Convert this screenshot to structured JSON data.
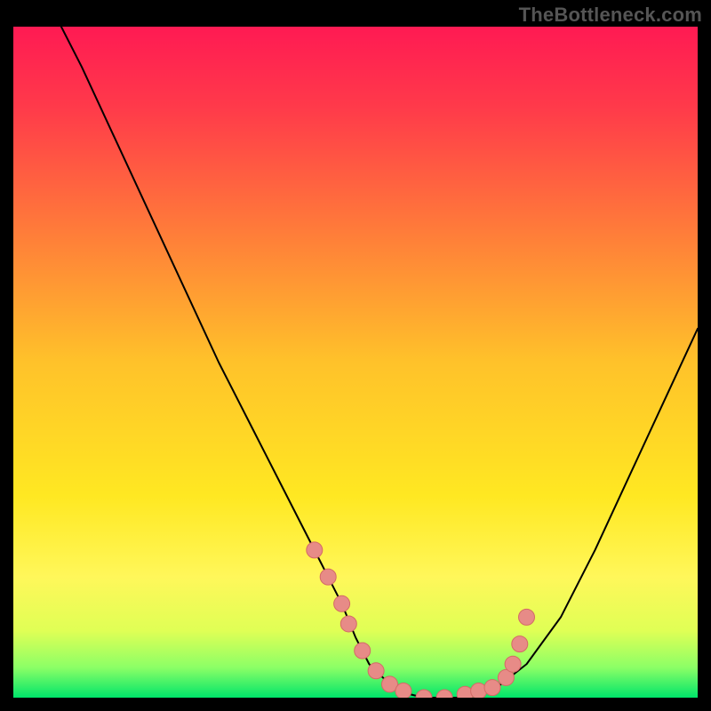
{
  "watermark": "TheBottleneck.com",
  "colors": {
    "frame": "#000000",
    "gradient_stops": [
      {
        "offset": 0.0,
        "color": "#ff1a53"
      },
      {
        "offset": 0.12,
        "color": "#ff3a4a"
      },
      {
        "offset": 0.3,
        "color": "#ff7a3a"
      },
      {
        "offset": 0.5,
        "color": "#ffc22a"
      },
      {
        "offset": 0.7,
        "color": "#ffe822"
      },
      {
        "offset": 0.82,
        "color": "#fff75a"
      },
      {
        "offset": 0.9,
        "color": "#e0ff55"
      },
      {
        "offset": 0.955,
        "color": "#8cff66"
      },
      {
        "offset": 1.0,
        "color": "#00e56a"
      }
    ],
    "curve": "#000000",
    "marker_fill": "#e78b87",
    "marker_stroke": "#d46a66"
  },
  "chart_data": {
    "type": "line",
    "title": "",
    "xlabel": "",
    "ylabel": "",
    "xlim": [
      0,
      100
    ],
    "ylim": [
      0,
      100
    ],
    "grid": false,
    "legend": null,
    "series": [
      {
        "name": "bottleneck-curve",
        "x": [
          7,
          10,
          15,
          20,
          25,
          30,
          35,
          40,
          45,
          48,
          50,
          52,
          55,
          58,
          60,
          62,
          65,
          70,
          75,
          80,
          85,
          90,
          95,
          100
        ],
        "y": [
          100,
          94,
          83,
          72,
          61,
          50,
          40,
          30,
          20,
          14,
          9,
          5,
          2,
          0.5,
          0,
          0,
          0,
          1,
          5,
          12,
          22,
          33,
          44,
          55
        ]
      }
    ],
    "markers": {
      "name": "highlight-points",
      "x": [
        44,
        46,
        48,
        49,
        51,
        53,
        55,
        57,
        60,
        63,
        66,
        68,
        70,
        72,
        73,
        74,
        75
      ],
      "y": [
        22,
        18,
        14,
        11,
        7,
        4,
        2,
        1,
        0,
        0,
        0.5,
        1,
        1.5,
        3,
        5,
        8,
        12
      ]
    }
  }
}
